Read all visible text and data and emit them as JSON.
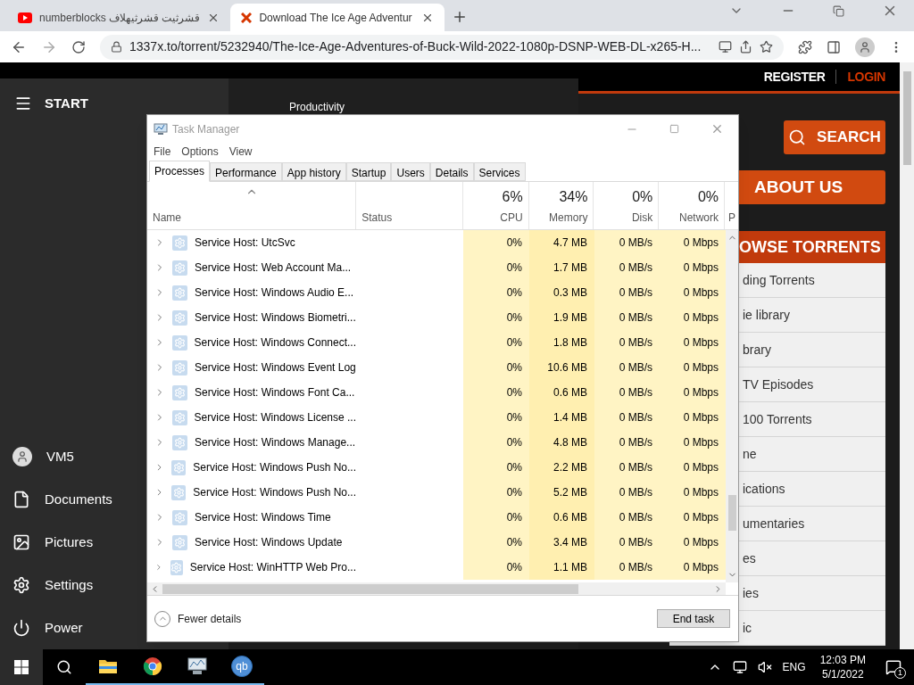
{
  "browser": {
    "tabs": [
      {
        "kind": "youtube",
        "title": "numberblocks قشرثيت قشرثيهلاف",
        "selected": false
      },
      {
        "kind": "site",
        "title": "Download The Ice Age Adventur",
        "selected": true
      }
    ],
    "url": "1337x.to/torrent/5232940/The-Ice-Age-Adventures-of-Buck-Wild-2022-1080p-DSNP-WEB-DL-x265-H..."
  },
  "site": {
    "register": "REGISTER",
    "login": "LOGIN",
    "search_button": "SEARCH",
    "about_button": "ABOUT US",
    "browse_header": "OWSE TORRENTS",
    "nav_items": [
      "ding Torrents",
      "ie library",
      "brary",
      "TV Episodes",
      "100 Torrents",
      "ne",
      "ications",
      "umentaries",
      "es",
      "ies",
      "ic"
    ]
  },
  "start_menu": {
    "title": "START",
    "group_label": "Productivity",
    "items": [
      {
        "kind": "user",
        "label": "VM5"
      },
      {
        "kind": "documents",
        "label": "Documents"
      },
      {
        "kind": "pictures",
        "label": "Pictures"
      },
      {
        "kind": "settings",
        "label": "Settings"
      },
      {
        "kind": "power",
        "label": "Power"
      }
    ]
  },
  "task_manager": {
    "title": "Task Manager",
    "menu": [
      "File",
      "Options",
      "View"
    ],
    "tabs": [
      {
        "label": "Processes",
        "selected": true
      },
      {
        "label": "Performance",
        "selected": false
      },
      {
        "label": "App history",
        "selected": false
      },
      {
        "label": "Startup",
        "selected": false
      },
      {
        "label": "Users",
        "selected": false
      },
      {
        "label": "Details",
        "selected": false
      },
      {
        "label": "Services",
        "selected": false
      }
    ],
    "columns": [
      {
        "label": "Name"
      },
      {
        "label": "Status"
      },
      {
        "label": "CPU",
        "total": "6%"
      },
      {
        "label": "Memory",
        "total": "34%"
      },
      {
        "label": "Disk",
        "total": "0%"
      },
      {
        "label": "Network",
        "total": "0%"
      }
    ],
    "column_7": "P",
    "rows": [
      {
        "name": "Service Host: UtcSvc",
        "cpu": "0%",
        "memory": "4.7 MB",
        "disk": "0 MB/s",
        "network": "0 Mbps"
      },
      {
        "name": "Service Host: Web Account Ma...",
        "cpu": "0%",
        "memory": "1.7 MB",
        "disk": "0 MB/s",
        "network": "0 Mbps"
      },
      {
        "name": "Service Host: Windows Audio E...",
        "cpu": "0%",
        "memory": "0.3 MB",
        "disk": "0 MB/s",
        "network": "0 Mbps"
      },
      {
        "name": "Service Host: Windows Biometri...",
        "cpu": "0%",
        "memory": "1.9 MB",
        "disk": "0 MB/s",
        "network": "0 Mbps"
      },
      {
        "name": "Service Host: Windows Connect...",
        "cpu": "0%",
        "memory": "1.8 MB",
        "disk": "0 MB/s",
        "network": "0 Mbps"
      },
      {
        "name": "Service Host: Windows Event Log",
        "cpu": "0%",
        "memory": "10.6 MB",
        "disk": "0 MB/s",
        "network": "0 Mbps"
      },
      {
        "name": "Service Host: Windows Font Ca...",
        "cpu": "0%",
        "memory": "0.6 MB",
        "disk": "0 MB/s",
        "network": "0 Mbps"
      },
      {
        "name": "Service Host: Windows License ...",
        "cpu": "0%",
        "memory": "1.4 MB",
        "disk": "0 MB/s",
        "network": "0 Mbps"
      },
      {
        "name": "Service Host: Windows Manage...",
        "cpu": "0%",
        "memory": "4.8 MB",
        "disk": "0 MB/s",
        "network": "0 Mbps"
      },
      {
        "name": "Service Host: Windows Push No...",
        "cpu": "0%",
        "memory": "2.2 MB",
        "disk": "0 MB/s",
        "network": "0 Mbps"
      },
      {
        "name": "Service Host: Windows Push No...",
        "cpu": "0%",
        "memory": "5.2 MB",
        "disk": "0 MB/s",
        "network": "0 Mbps"
      },
      {
        "name": "Service Host: Windows Time",
        "cpu": "0%",
        "memory": "0.6 MB",
        "disk": "0 MB/s",
        "network": "0 Mbps"
      },
      {
        "name": "Service Host: Windows Update",
        "cpu": "0%",
        "memory": "3.4 MB",
        "disk": "0 MB/s",
        "network": "0 Mbps"
      },
      {
        "name": "Service Host: WinHTTP Web Pro...",
        "cpu": "0%",
        "memory": "1.1 MB",
        "disk": "0 MB/s",
        "network": "0 Mbps"
      }
    ],
    "fewer_details": "Fewer details",
    "end_task": "End task"
  },
  "taskbar": {
    "apps": [
      {
        "kind": "explorer",
        "running": true
      },
      {
        "kind": "chrome",
        "running": true
      },
      {
        "kind": "taskmgr",
        "running": true
      },
      {
        "kind": "qbittorrent",
        "label": "qb",
        "running": true
      }
    ],
    "language": "ENG",
    "time": "12:03 PM",
    "date": "5/1/2022",
    "notification_count": "1"
  }
}
